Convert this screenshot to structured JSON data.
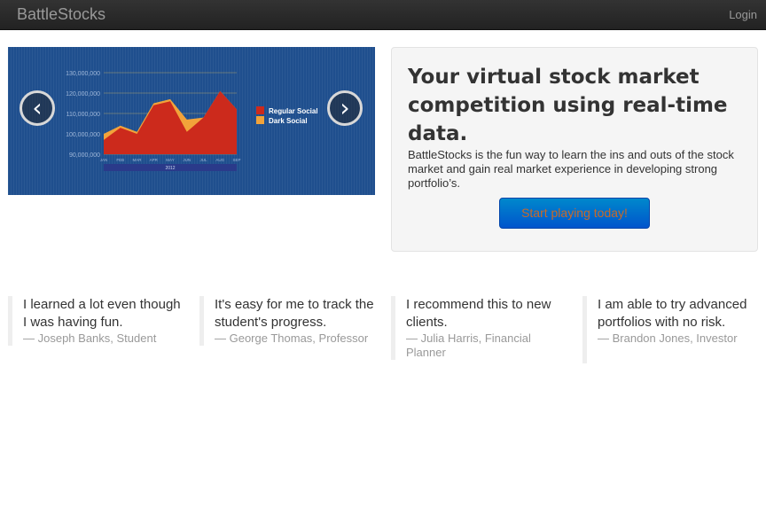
{
  "navbar": {
    "brand": "BattleStocks",
    "login": "Login"
  },
  "carousel": {
    "prev_icon": "chevron-left-icon",
    "next_icon": "chevron-right-icon",
    "slide_chart": {
      "y_ticks": [
        "130,000,000",
        "120,000,000",
        "110,000,000",
        "100,000,000",
        "90,000,000"
      ],
      "x_ticks": [
        "JAN",
        "FEB",
        "MAR",
        "APR",
        "MAY",
        "JUN",
        "JUL",
        "AUG",
        "SEP"
      ],
      "year": "2012",
      "legend": [
        {
          "name": "Regular Social",
          "color": "#cc2a1c"
        },
        {
          "name": "Dark Social",
          "color": "#f2a33a"
        }
      ],
      "regular_social": [
        97,
        103,
        100,
        114,
        116,
        101,
        108,
        121,
        112
      ],
      "dark_social": [
        100,
        104,
        101,
        115,
        117,
        107,
        108,
        121,
        112
      ]
    }
  },
  "hero": {
    "title": "Your virtual stock market competition using real-time data.",
    "body": "BattleStocks is the fun way to learn the ins and outs of the stock market and gain real market experience in developing strong portfolio’s.",
    "cta": "Start playing today!"
  },
  "testimonials": [
    {
      "quote": "I learned a lot even though I was having fun.",
      "author": "— Joseph Banks, Student"
    },
    {
      "quote": "It's easy for me to track the student's progress.",
      "author": "— George Thomas, Professor"
    },
    {
      "quote": "I recommend this to new clients.",
      "author": "— Julia Harris, Financial Planner"
    },
    {
      "quote": "I am able to try advanced portfolios with no risk.",
      "author": "— Brandon Jones, Investor"
    }
  ],
  "colors": {
    "navbar": "#222222",
    "primary": "#0069d4",
    "carousel_bg": "#1f4f8e"
  }
}
